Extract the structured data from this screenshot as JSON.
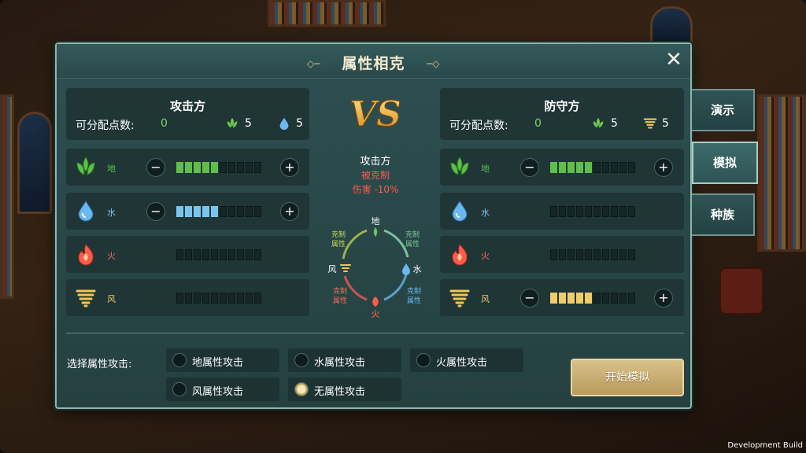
{
  "title": "属性相克",
  "attacker": {
    "title": "攻击方",
    "points_label": "可分配点数:",
    "points_value": "0",
    "resources": [
      {
        "icon": "earth-icon",
        "value": "5"
      },
      {
        "icon": "water-icon",
        "value": "5"
      }
    ],
    "elements": [
      {
        "name": "earth",
        "label": "地",
        "level": 5,
        "max": 10,
        "controls": true,
        "color": "#5ec04a"
      },
      {
        "name": "water",
        "label": "水",
        "level": 5,
        "max": 10,
        "controls": true,
        "color": "#7cc4f0"
      },
      {
        "name": "fire",
        "label": "火",
        "level": 0,
        "max": 10,
        "controls": false,
        "color": "#ff6a5a"
      },
      {
        "name": "wind",
        "label": "风",
        "level": 0,
        "max": 10,
        "controls": false,
        "color": "#f0cd6a"
      }
    ]
  },
  "defender": {
    "title": "防守方",
    "points_label": "可分配点数:",
    "points_value": "0",
    "resources": [
      {
        "icon": "earth-icon",
        "value": "5"
      },
      {
        "icon": "wind-icon",
        "value": "5"
      }
    ],
    "elements": [
      {
        "name": "earth",
        "label": "地",
        "level": 5,
        "max": 10,
        "controls": true,
        "color": "#5ec04a"
      },
      {
        "name": "water",
        "label": "水",
        "level": 0,
        "max": 10,
        "controls": false,
        "color": "#7cc4f0"
      },
      {
        "name": "fire",
        "label": "火",
        "level": 0,
        "max": 10,
        "controls": false,
        "color": "#ff6a5a"
      },
      {
        "name": "wind",
        "label": "风",
        "level": 5,
        "max": 10,
        "controls": true,
        "color": "#f0cd6a"
      }
    ]
  },
  "center": {
    "vs": "VS",
    "side": "攻击方",
    "status": "被克制",
    "damage": "伤害 -10%",
    "cycle": {
      "earth": "地",
      "water": "水",
      "fire": "火",
      "wind": "风",
      "counter_label_1": "克制",
      "counter_label_2": "属性"
    }
  },
  "select": {
    "label": "选择属性攻击:",
    "options": [
      {
        "label": "地属性攻击",
        "selected": false
      },
      {
        "label": "水属性攻击",
        "selected": false
      },
      {
        "label": "火属性攻击",
        "selected": false
      },
      {
        "label": "风属性攻击",
        "selected": false
      },
      {
        "label": "无属性攻击",
        "selected": true
      }
    ]
  },
  "start_button": "开始模拟",
  "side_tabs": [
    {
      "label": "演示",
      "active": false
    },
    {
      "label": "模拟",
      "active": true
    },
    {
      "label": "种族",
      "active": false
    }
  ],
  "footer": "Development Build",
  "colors": {
    "plus_text": "#ffffff",
    "minus_text": "#ffffff",
    "status_red": "#ff5a4a",
    "accent_gold": "#e8c060"
  }
}
